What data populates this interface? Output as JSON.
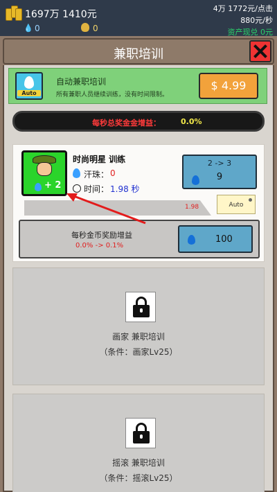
{
  "topbar": {
    "money": "1697万 1410元",
    "sweat_count": "0",
    "bag_count": "0",
    "per_click": "4万 1772元/点击",
    "per_second": "880元/秒",
    "cash_out": "资产现兑 0元"
  },
  "header": {
    "title": "兼职培训"
  },
  "auto_training": {
    "title": "自动兼职培训",
    "description": "所有兼职人员继续训练，没有时间限制。",
    "icon_label": "Auto",
    "price": "$ 4.99"
  },
  "bonus_bar": {
    "label": "每秒总奖金金增益：",
    "value": "0.0%"
  },
  "active_card": {
    "title": "时尚明星 训练",
    "avatar_badge": "+ 2",
    "sweat_label": "汗珠：",
    "sweat_value": "0",
    "time_label": "时间：",
    "time_value": "1.98 秒",
    "level_change": "2 -> 3",
    "upgrade_cost": "9",
    "progress_text": "1.98",
    "progress_fraction": 0.0,
    "auto_label": "Auto",
    "reward_title": "每秒金币奖励增益",
    "reward_change": "0.0% -> 0.1%",
    "reward_cost": "100"
  },
  "locked_cards": [
    {
      "title": "画家 兼职培训",
      "condition": "（条件：画家Lv25）"
    },
    {
      "title": "摇滚 兼职培训",
      "condition": "（条件：摇滚Lv25）"
    }
  ],
  "colors": {
    "accent_red": "#e02020",
    "button_blue": "#5fa7c9",
    "price_orange": "#f2a23b",
    "banner_green": "#7fd17a"
  }
}
